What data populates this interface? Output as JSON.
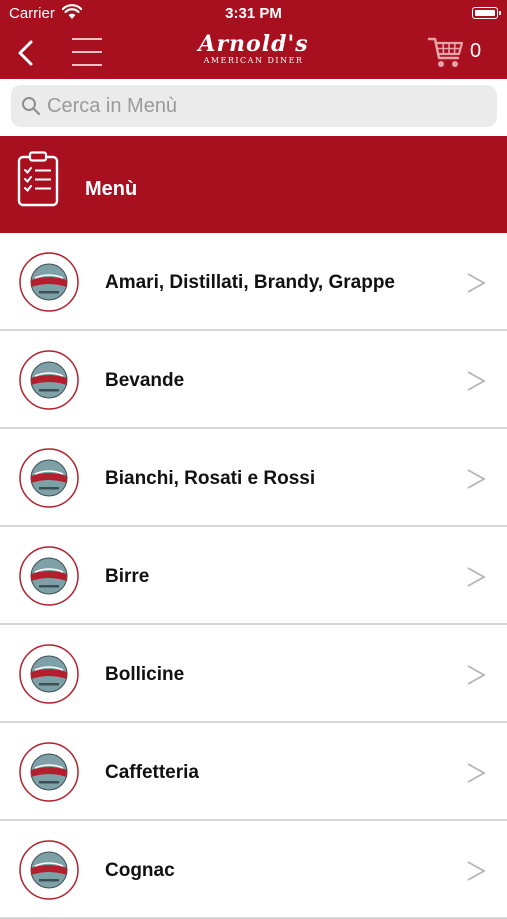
{
  "status_bar": {
    "carrier": "Carrier",
    "time": "3:31 PM"
  },
  "nav": {
    "brand_name": "Arnold's",
    "brand_subtitle": "AMERICAN DINER",
    "cart_count": "0"
  },
  "search": {
    "placeholder": "Cerca in Menù"
  },
  "section": {
    "title": "Menù"
  },
  "categories": [
    "Amari, Distillati, Brandy, Grappe",
    "Bevande",
    "Bianchi, Rosati e Rossi",
    "Birre",
    "Bollicine",
    "Caffetteria",
    "Cognac"
  ],
  "colors": {
    "brand_red": "#a8101f",
    "search_bg": "#ebebeb",
    "divider": "#d6d6d6",
    "chevron": "#b5b5b5"
  },
  "icons": {
    "back": "chevron-left-icon",
    "menu": "hamburger-icon",
    "cart": "cart-icon",
    "search": "search-icon",
    "section": "clipboard-icon",
    "row_logo": "arnolds-logo",
    "row_arrow": "chevron-right-icon"
  }
}
